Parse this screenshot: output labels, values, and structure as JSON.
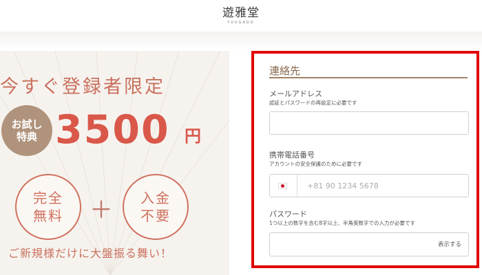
{
  "header": {
    "logo": "遊雅堂",
    "logo_sub": "YUUGADO"
  },
  "banner": {
    "headline": "今すぐ登録者限定",
    "trial_line1": "お試し",
    "trial_line2": "特典",
    "amount": "3500",
    "amount_unit": "円",
    "badge1_line1": "完全",
    "badge1_line2": "無料",
    "plus": "＋",
    "badge2_line1": "入金",
    "badge2_line2": "不要",
    "tagline": "ご新規様だけに大盤振る舞い！"
  },
  "form": {
    "section_title": "連絡先",
    "email": {
      "label": "メールアドレス",
      "help": "認証とパスワードの再設定に必要です",
      "value": ""
    },
    "phone": {
      "label": "携帯電話番号",
      "help": "アカウントの安全保護のために必要です",
      "placeholder": "+81 90 1234 5678",
      "value": ""
    },
    "password": {
      "label": "パスワード",
      "help": "1つ以上の数字を含む8字以上、半角英数字での入力が必要です",
      "value": "",
      "show_label": "表示する"
    },
    "highlight_color": "#e00000"
  }
}
